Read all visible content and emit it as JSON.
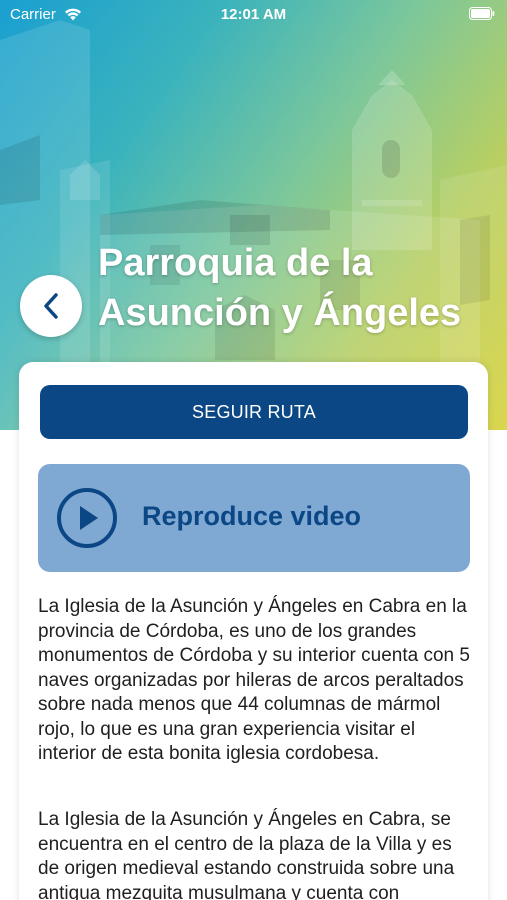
{
  "status_bar": {
    "carrier": "Carrier",
    "time": "12:01 AM"
  },
  "header": {
    "title": "Parroquia de la Asunción y Ángeles"
  },
  "actions": {
    "route_button": "SEGUIR RUTA",
    "video_label": "Reproduce video"
  },
  "content": {
    "paragraphs": [
      "La Iglesia de la Asunción y Ángeles en Cabra en la provincia de Córdoba, es uno de los grandes monumentos de Córdoba y su interior cuenta con 5 naves organizadas por hileras de arcos peraltados sobre nada menos que 44 columnas de mármol rojo, lo que es una gran experiencia visitar el interior de esta bonita iglesia cordobesa.",
      "La Iglesia de la Asunción y Ángeles en Cabra, se encuentra en el centro de la plaza de la Villa y es de origen medieval estando construida sobre una antigua mezquita musulmana y cuenta con"
    ]
  },
  "colors": {
    "primary": "#0c4785",
    "video_bg": "#7fa8d3",
    "hero_gradient": [
      "#1a9fd0",
      "#7cc79b",
      "#d6d23a"
    ]
  },
  "icons": [
    "wifi-icon",
    "battery-icon",
    "chevron-left-icon",
    "play-circle-icon"
  ]
}
